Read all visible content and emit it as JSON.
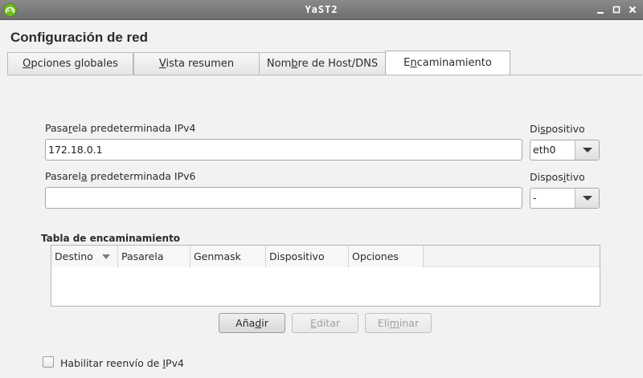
{
  "window": {
    "title": "YaST2",
    "controls": [
      "minimize-icon",
      "maximize-icon",
      "close-icon"
    ]
  },
  "dialog": {
    "heading": "Configuración de red"
  },
  "tabs": [
    {
      "pre": "",
      "key": "O",
      "post": "pciones globales",
      "active": false
    },
    {
      "pre": "",
      "key": "V",
      "post": "ista resumen",
      "active": false
    },
    {
      "pre": "Nom",
      "key": "b",
      "post": "re de Host/DNS",
      "active": false
    },
    {
      "pre": "E",
      "key": "n",
      "post": "caminamiento",
      "active": true
    }
  ],
  "ipv4": {
    "label_pre": "Pasa",
    "label_key": "r",
    "label_post": "ela predeterminada IPv4",
    "value": "172.18.0.1",
    "device_label_pre": "Di",
    "device_label_key": "s",
    "device_label_post": "positivo",
    "device_value": "eth0"
  },
  "ipv6": {
    "label_pre": "Pasarel",
    "label_key": "a",
    "label_post": " predeterminada IPv6",
    "value": "",
    "device_label_pre": "Dispos",
    "device_label_key": "i",
    "device_label_post": "tivo",
    "device_value": "-"
  },
  "routing_table": {
    "title": "Tabla de encaminamiento",
    "columns": [
      "Destino",
      "Pasarela",
      "Genmask",
      "Dispositivo",
      "Opciones"
    ],
    "rows": []
  },
  "buttons": {
    "add": {
      "pre": "Aña",
      "key": "d",
      "post": "ir",
      "enabled": true
    },
    "edit": {
      "pre": "",
      "key": "E",
      "post": "ditar",
      "enabled": false
    },
    "delete": {
      "pre": "Eli",
      "key": "m",
      "post": "inar",
      "enabled": false
    }
  },
  "checkboxes": [
    {
      "pre": "Habilitar reenvío de ",
      "key": "I",
      "post": "Pv4",
      "checked": false
    }
  ],
  "colors": {
    "titlebar": "#7a7a7a",
    "background": "#f2f2f2",
    "app_icon": "#73ba25"
  }
}
